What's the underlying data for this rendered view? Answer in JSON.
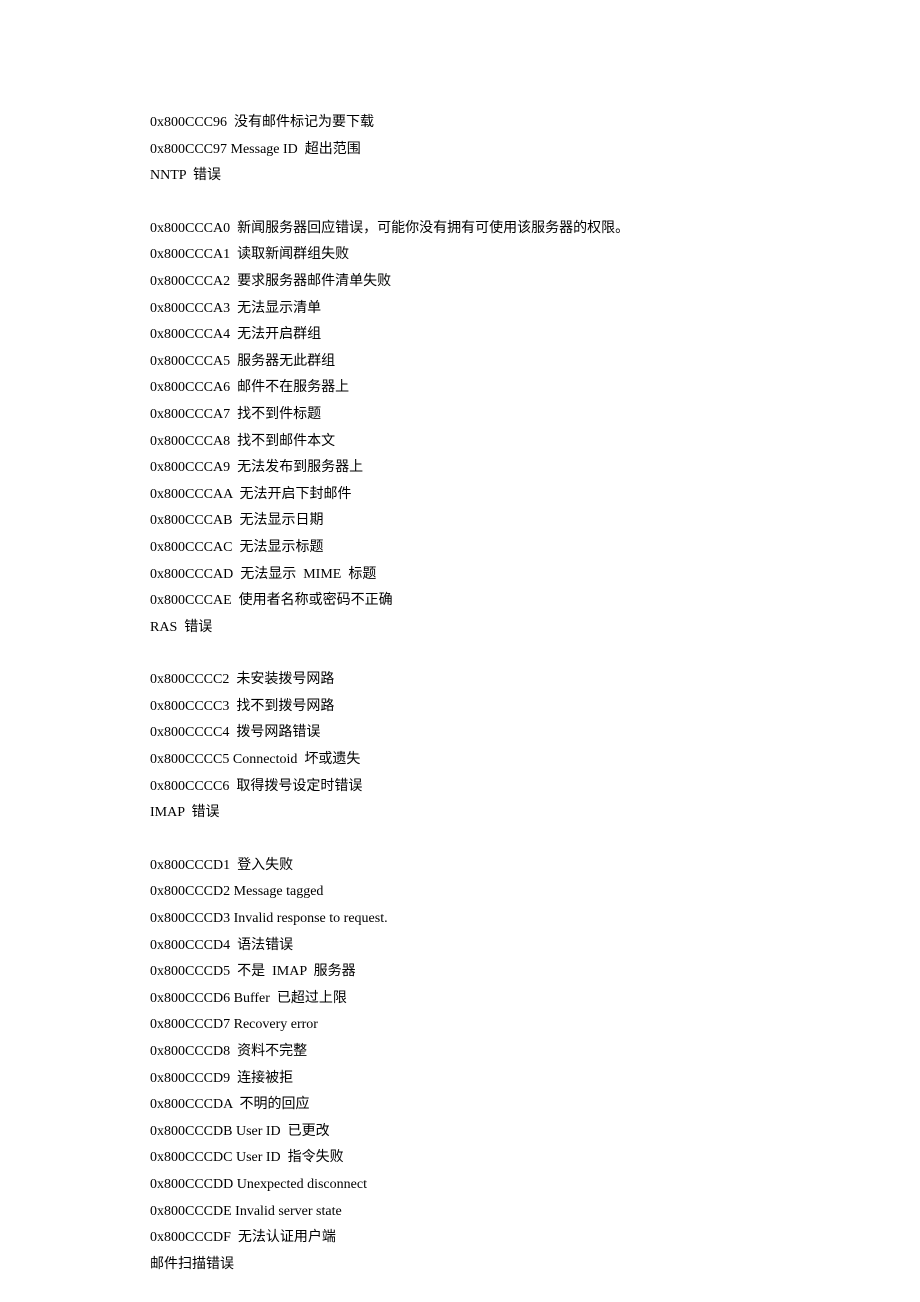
{
  "lines": [
    "0x800CCC96  没有邮件标记为要下载",
    "0x800CCC97 Message ID  超出范围",
    "NNTP  错误",
    "",
    "0x800CCCA0  新闻服务器回应错误，可能你没有拥有可使用该服务器的权限。",
    "0x800CCCA1  读取新闻群组失败",
    "0x800CCCA2  要求服务器邮件清单失败",
    "0x800CCCA3  无法显示清单",
    "0x800CCCA4  无法开启群组",
    "0x800CCCA5  服务器无此群组",
    "0x800CCCA6  邮件不在服务器上",
    "0x800CCCA7  找不到件标题",
    "0x800CCCA8  找不到邮件本文",
    "0x800CCCA9  无法发布到服务器上",
    "0x800CCCAA  无法开启下封邮件",
    "0x800CCCAB  无法显示日期",
    "0x800CCCAC  无法显示标题",
    "0x800CCCAD  无法显示  MIME  标题",
    "0x800CCCAE  使用者名称或密码不正确",
    "RAS  错误",
    "",
    "0x800CCCC2  未安装拨号网路",
    "0x800CCCC3  找不到拨号网路",
    "0x800CCCC4  拨号网路错误",
    "0x800CCCC5 Connectoid  坏或遗失",
    "0x800CCCC6  取得拨号设定时错误",
    "IMAP  错误",
    "",
    "0x800CCCD1  登入失败",
    "0x800CCCD2 Message tagged",
    "0x800CCCD3 Invalid response to request.",
    "0x800CCCD4  语法错误",
    "0x800CCCD5  不是  IMAP  服务器",
    "0x800CCCD6 Buffer  已超过上限",
    "0x800CCCD7 Recovery error",
    "0x800CCCD8  资料不完整",
    "0x800CCCD9  连接被拒",
    "0x800CCCDA  不明的回应",
    "0x800CCCDB User ID  已更改",
    "0x800CCCDC User ID  指令失败",
    "0x800CCCDD Unexpected disconnect",
    "0x800CCCDE Invalid server state",
    "0x800CCCDF  无法认证用户端",
    "邮件扫描错误"
  ]
}
